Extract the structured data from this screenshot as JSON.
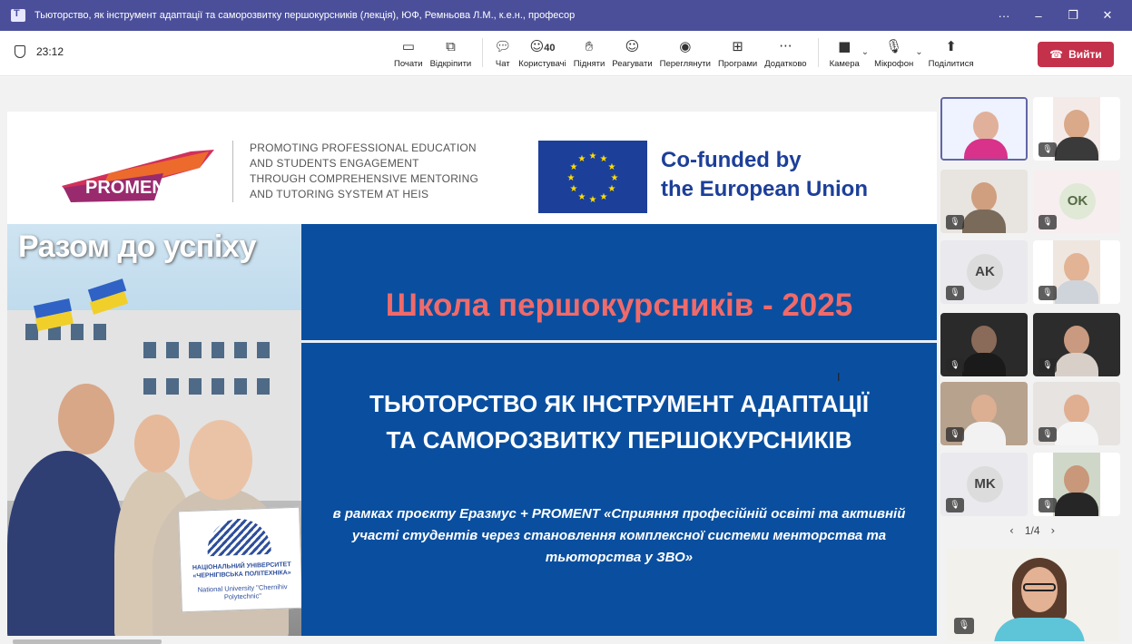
{
  "window": {
    "title": "Тьюторство, як інструмент адаптації та саморозвитку першокурсників (лекція), ЮФ, Ремньова Л.М., к.е.н., професор",
    "more": "···",
    "minimize": "–",
    "restore": "❐",
    "close": "✕"
  },
  "toolbar": {
    "elapsed": "23:12",
    "participants_count": "40",
    "items": [
      {
        "label": "Почати",
        "icon": "share-screen-icon"
      },
      {
        "label": "Відкріпити",
        "icon": "pop-out-icon"
      },
      {
        "label": "Чат",
        "icon": "chat-icon"
      },
      {
        "label": "Користувачі",
        "icon": "people-icon"
      },
      {
        "label": "Підняти",
        "icon": "raise-hand-icon"
      },
      {
        "label": "Реагувати",
        "icon": "react-icon"
      },
      {
        "label": "Переглянути",
        "icon": "view-icon"
      },
      {
        "label": "Програми",
        "icon": "apps-icon"
      },
      {
        "label": "Додатково",
        "icon": "more-icon"
      },
      {
        "label": "Камера",
        "icon": "camera-off-icon"
      },
      {
        "label": "Мікрофон",
        "icon": "mic-off-icon"
      },
      {
        "label": "Поділитися",
        "icon": "share-icon"
      }
    ],
    "leave_label": "Вийти"
  },
  "slide": {
    "proment_logo_text": "PROMENT",
    "proment_tagline": [
      "PROMOTING PROFESSIONAL EDUCATION",
      "AND STUDENTS ENGAGEMENT",
      "THROUGH COMPREHENSIVE MENTORING",
      "AND TUTORING SYSTEM AT HEIS"
    ],
    "eu_text": [
      "Co-funded by",
      "the European Union"
    ],
    "photo_caption": "Разом до успіху",
    "card_text_1": "НАЦІОНАЛЬНИЙ УНІВЕРСИТЕТ «ЧЕРНІГІВСЬКА ПОЛІТЕХНІКА»",
    "card_text_2": "National University \"Chernihiv Polytechnic\"",
    "school_title": "Школа першокурсників - 2025",
    "main_title": [
      "ТЬЮТОРСТВО ЯК ІНСТРУМЕНТ АДАПТАЦІЇ",
      "ТА САМОРОЗВИТКУ ПЕРШОКУРСНИКІВ"
    ],
    "project_text": [
      "в рамках проєкту Еразмус + PROMENT «Сприяння професійній освіті та активній",
      "участі студентів через становлення комплексної системи менторства та",
      "тьюторства у ЗВО»"
    ]
  },
  "participants": {
    "initials": [
      "OK",
      "AK",
      "MK"
    ],
    "pager": "1/4"
  },
  "colors": {
    "titlebar": "#4b4f9a",
    "leave": "#c4314b",
    "slide_blue": "#0a4f9f",
    "school_title": "#f06a6a",
    "eu_blue": "#1c3f99"
  }
}
